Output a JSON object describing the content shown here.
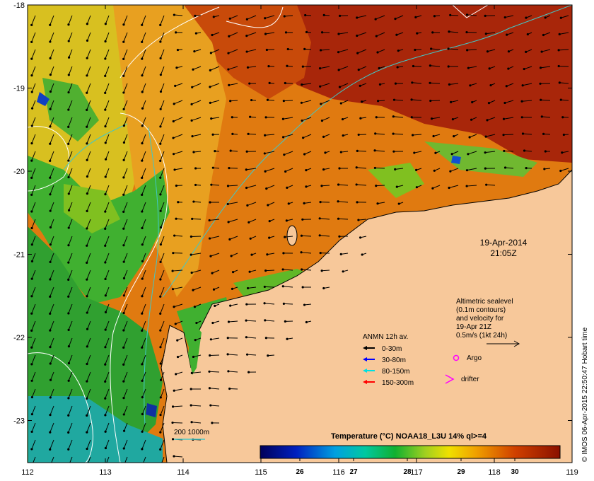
{
  "map": {
    "lon_ticks": [
      "112",
      "113",
      "114",
      "115",
      "116",
      "117",
      "118",
      "119"
    ],
    "lat_ticks": [
      "-18",
      "-19",
      "-20",
      "-21",
      "-22",
      "-23"
    ],
    "date": "19-Apr-2014",
    "time": "21:05Z"
  },
  "altimetry_note": {
    "lines": [
      "Altimetric sealevel",
      "(0.1m contours)",
      "and velocity for",
      "19-Apr 21Z",
      "0.5m/s (1kt 24h)"
    ]
  },
  "anmn_legend": {
    "title": "ANMN 12h av.",
    "items": [
      {
        "label": "0-30m",
        "color": "#000000"
      },
      {
        "label": "30-80m",
        "color": "#0000ff"
      },
      {
        "label": "80-150m",
        "color": "#00e0e0"
      },
      {
        "label": "150-300m",
        "color": "#ff0000"
      }
    ]
  },
  "markers": {
    "argo_label": "Argo",
    "argo_color": "#ff00ff",
    "drifter_label": "drifter",
    "drifter_color": "#ff00ff"
  },
  "isobath_label": "200  1000m",
  "colorbar": {
    "title": "Temperature (°C) NOAA18_L3U 14% ql>=4",
    "ticks": [
      "26",
      "27",
      "28",
      "29",
      "30"
    ]
  },
  "credit": "© IMOS 06-Apr-2015 22:50:47 Hobart time",
  "colors": {
    "land": "#f7c89a",
    "sst_warm": "#a01e00",
    "sst_mid": "#f0c000",
    "sst_cool": "#20a020",
    "contour_white": "#ffffff",
    "isobath_cyan": "#40c8c8"
  }
}
